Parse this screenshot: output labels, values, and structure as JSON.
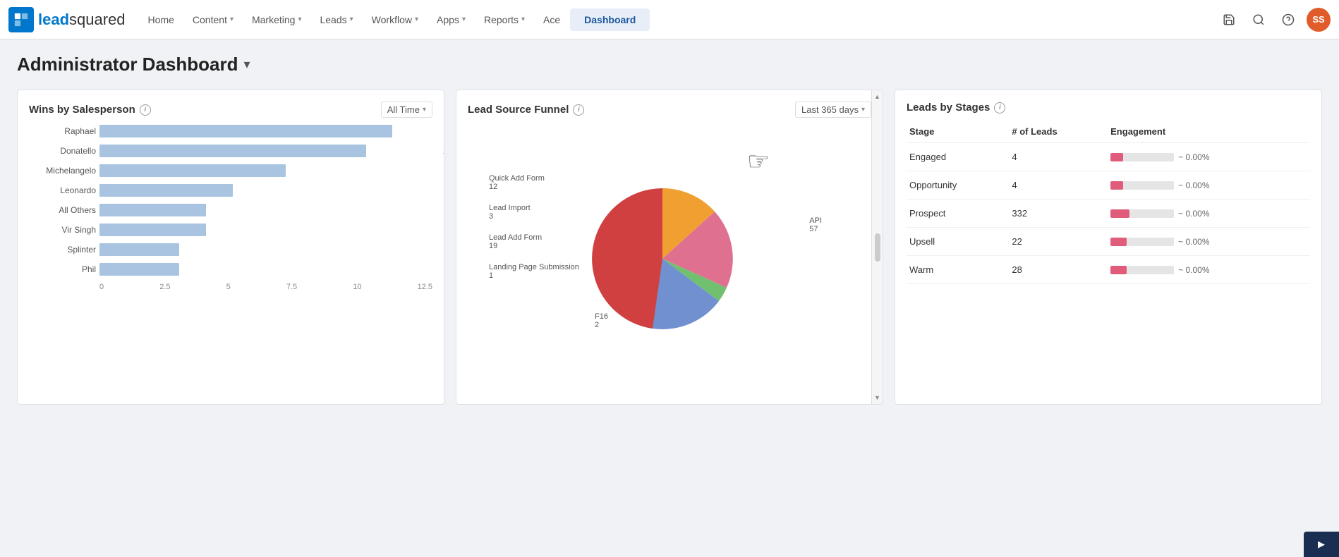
{
  "logo": {
    "text_lead": "lead",
    "text_squared": "squared",
    "initials": "SS"
  },
  "nav": {
    "home": "Home",
    "content": "Content",
    "marketing": "Marketing",
    "leads": "Leads",
    "workflow": "Workflow",
    "apps": "Apps",
    "reports": "Reports",
    "ace": "Ace",
    "dashboard": "Dashboard"
  },
  "page": {
    "title": "Administrator Dashboard"
  },
  "wins_card": {
    "title": "Wins by Salesperson",
    "filter": "All Time",
    "bars": [
      {
        "label": "Raphael",
        "value": 11,
        "max": 12.5
      },
      {
        "label": "Donatello",
        "value": 10,
        "max": 12.5
      },
      {
        "label": "Michelangelo",
        "value": 7,
        "max": 12.5
      },
      {
        "label": "Leonardo",
        "value": 5,
        "max": 12.5
      },
      {
        "label": "All Others",
        "value": 4,
        "max": 12.5
      },
      {
        "label": "Vir Singh",
        "value": 4,
        "max": 12.5
      },
      {
        "label": "Splinter",
        "value": 3,
        "max": 12.5
      },
      {
        "label": "Phil",
        "value": 3,
        "max": 12.5
      }
    ],
    "x_labels": [
      "0",
      "2.5",
      "5",
      "7.5",
      "10",
      "12.5"
    ]
  },
  "funnel_card": {
    "title": "Lead Source Funnel",
    "filter": "Last 365 days",
    "slices": [
      {
        "label": "Quick Add Form",
        "value": "12",
        "color": "#e07090"
      },
      {
        "label": "Lead Import",
        "value": "3",
        "color": "#70c070"
      },
      {
        "label": "Lead Add Form",
        "value": "19",
        "color": "#7090d0"
      },
      {
        "label": "Landing Page Submission",
        "value": "1",
        "color": "#70c0c0"
      },
      {
        "label": "F16",
        "value": "2",
        "color": "#d04040"
      },
      {
        "label": "API",
        "value": "57",
        "color": "#f0a030"
      }
    ]
  },
  "stages_card": {
    "title": "Leads by Stages",
    "columns": [
      "Stage",
      "# of Leads",
      "Engagement"
    ],
    "rows": [
      {
        "stage": "Engaged",
        "leads": 4,
        "pct": "~ 0.00%",
        "bar_pct": 20
      },
      {
        "stage": "Opportunity",
        "leads": 4,
        "pct": "~ 0.00%",
        "bar_pct": 20
      },
      {
        "stage": "Prospect",
        "leads": 332,
        "pct": "~ 0.00%",
        "bar_pct": 30
      },
      {
        "stage": "Upsell",
        "leads": 22,
        "pct": "~ 0.00%",
        "bar_pct": 25
      },
      {
        "stage": "Warm",
        "leads": 28,
        "pct": "~ 0.00%",
        "bar_pct": 25
      }
    ]
  }
}
